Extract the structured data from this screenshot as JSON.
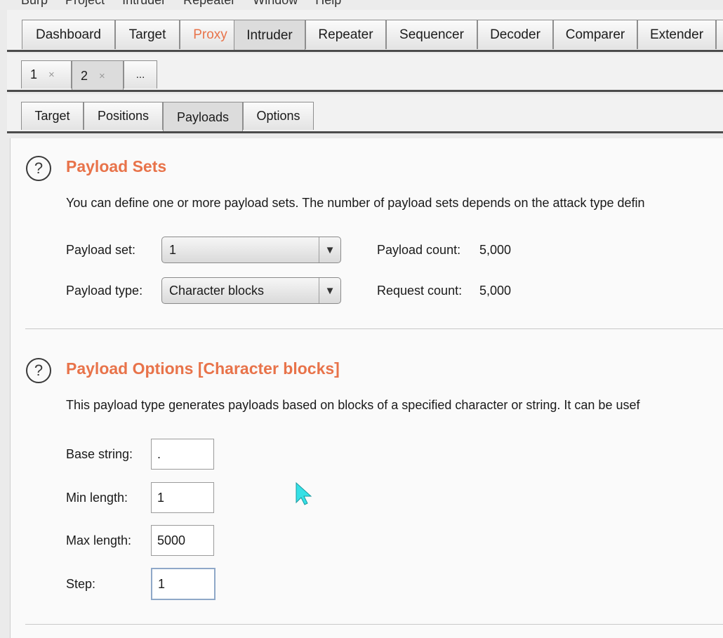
{
  "menu": [
    "Burp",
    "Project",
    "Intruder",
    "Repeater",
    "Window",
    "Help"
  ],
  "main_tabs": [
    "Dashboard",
    "Target",
    "Proxy",
    "Intruder",
    "Repeater",
    "Sequencer",
    "Decoder",
    "Comparer",
    "Extender"
  ],
  "attack_tabs": [
    {
      "label": "1",
      "close": "×"
    },
    {
      "label": "2",
      "close": "×"
    },
    {
      "label": "..."
    }
  ],
  "sub_tabs": [
    "Target",
    "Positions",
    "Payloads",
    "Options"
  ],
  "payload_sets": {
    "help": "?",
    "title": "Payload Sets",
    "description": "You can define one or more payload sets. The number of payload sets depends on the attack type defin",
    "set_label": "Payload set:",
    "set_value": "1",
    "type_label": "Payload type:",
    "type_value": "Character blocks",
    "payload_count_label": "Payload count:",
    "payload_count_value": "5,000",
    "request_count_label": "Request count:",
    "request_count_value": "5,000"
  },
  "payload_options": {
    "help": "?",
    "title": "Payload Options [Character blocks]",
    "description": "This payload type generates payloads based on blocks of a specified character or string. It can be usef",
    "base_string_label": "Base string:",
    "base_string_value": ".",
    "min_length_label": "Min length:",
    "min_length_value": "1",
    "max_length_label": "Max length:",
    "max_length_value": "5000",
    "step_label": "Step:",
    "step_value": "1"
  },
  "icons": {
    "dropdown_arrow": "▼",
    "cursor": "mouse-pointer"
  },
  "colors": {
    "accent": "#e8734a",
    "cursor": "#35e0e6"
  }
}
